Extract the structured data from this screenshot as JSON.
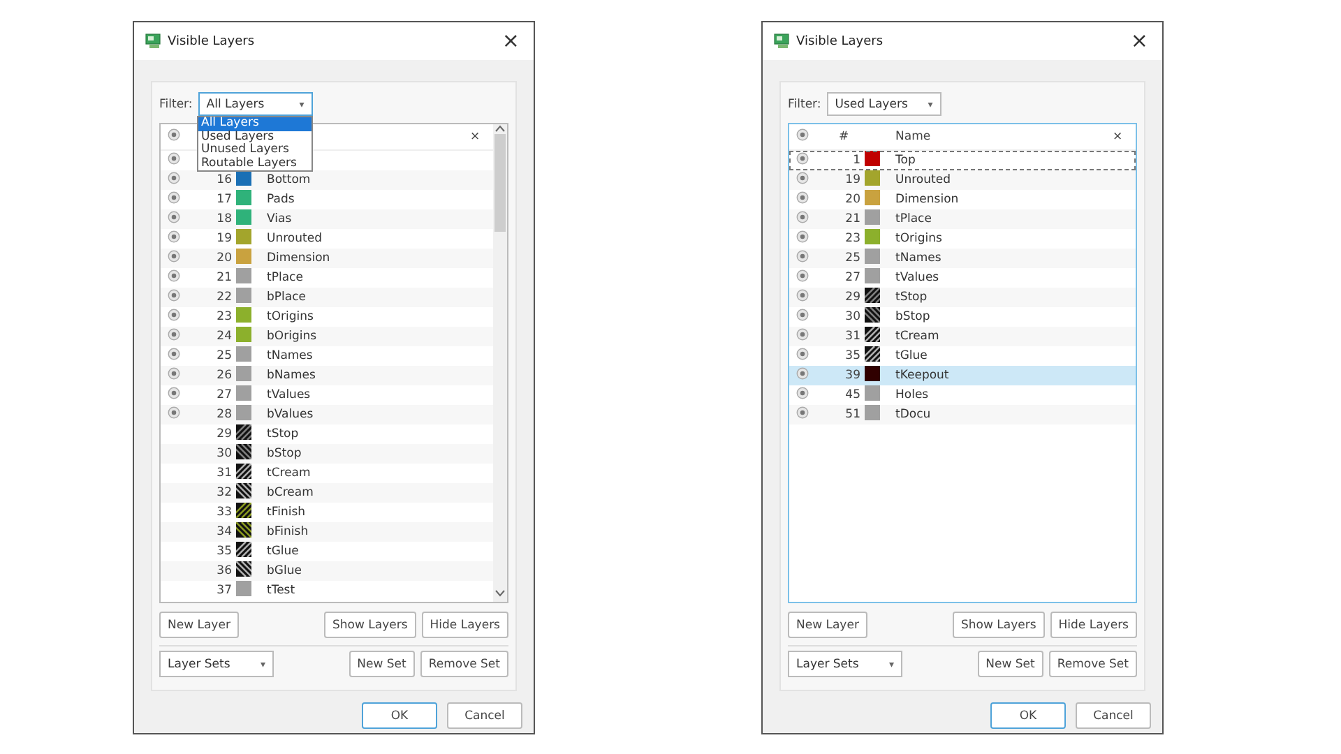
{
  "dialogs": [
    {
      "title": "Visible Layers",
      "close": "×",
      "filter": {
        "label": "Filter:",
        "value": "All Layers",
        "caret": "▾",
        "focused": true,
        "open": true,
        "options": [
          {
            "label": "All Layers",
            "selected": true
          },
          {
            "label": "Used Layers",
            "selected": false
          },
          {
            "label": "Unused Layers",
            "selected": false
          },
          {
            "label": "Routable Layers",
            "selected": false
          }
        ]
      },
      "table": {
        "header": {
          "close": "×"
        },
        "scrollbar": true,
        "rows": [
          {
            "visible": true,
            "selected": false
          },
          {
            "visible": true,
            "number": "16",
            "color": "#1a6fb5",
            "kind": "solid",
            "name": "Bottom",
            "selected": false
          },
          {
            "visible": true,
            "number": "17",
            "color": "#2fb27a",
            "kind": "solid",
            "name": "Pads",
            "selected": false
          },
          {
            "visible": true,
            "number": "18",
            "color": "#2fb27a",
            "kind": "solid",
            "name": "Vias",
            "selected": false
          },
          {
            "visible": true,
            "number": "19",
            "color": "#a3a52c",
            "kind": "solid",
            "name": "Unrouted",
            "selected": false
          },
          {
            "visible": true,
            "number": "20",
            "color": "#c9a23f",
            "kind": "solid",
            "name": "Dimension",
            "selected": false
          },
          {
            "visible": true,
            "number": "21",
            "color": "#a0a0a0",
            "kind": "solid",
            "name": "tPlace",
            "selected": false
          },
          {
            "visible": true,
            "number": "22",
            "color": "#a0a0a0",
            "kind": "solid",
            "name": "bPlace",
            "selected": false
          },
          {
            "visible": true,
            "number": "23",
            "color": "#8cb02c",
            "kind": "solid",
            "name": "tOrigins",
            "selected": false
          },
          {
            "visible": true,
            "number": "24",
            "color": "#8cb02c",
            "kind": "solid",
            "name": "bOrigins",
            "selected": false
          },
          {
            "visible": true,
            "number": "25",
            "color": "#a0a0a0",
            "kind": "solid",
            "name": "tNames",
            "selected": false
          },
          {
            "visible": true,
            "number": "26",
            "color": "#a0a0a0",
            "kind": "solid",
            "name": "bNames",
            "selected": false
          },
          {
            "visible": true,
            "number": "27",
            "color": "#a0a0a0",
            "kind": "solid",
            "name": "tValues",
            "selected": false
          },
          {
            "visible": true,
            "number": "28",
            "color": "#a0a0a0",
            "kind": "solid",
            "name": "bValues",
            "selected": false
          },
          {
            "visible": false,
            "number": "29",
            "color": "#808080",
            "kind": "hatch_up",
            "name": "tStop",
            "selected": false
          },
          {
            "visible": false,
            "number": "30",
            "color": "#808080",
            "kind": "hatch_down",
            "name": "bStop",
            "selected": false
          },
          {
            "visible": false,
            "number": "31",
            "color": "#b0b0b0",
            "kind": "hatch_up",
            "name": "tCream",
            "selected": false
          },
          {
            "visible": false,
            "number": "32",
            "color": "#b0b0b0",
            "kind": "hatch_down",
            "name": "bCream",
            "selected": false
          },
          {
            "visible": false,
            "number": "33",
            "color": "#8a9a20",
            "kind": "hatch_up",
            "name": "tFinish",
            "selected": false
          },
          {
            "visible": false,
            "number": "34",
            "color": "#8a9a20",
            "kind": "hatch_down",
            "name": "bFinish",
            "selected": false
          },
          {
            "visible": false,
            "number": "35",
            "color": "#b0b0b0",
            "kind": "hatch_up",
            "name": "tGlue",
            "selected": false
          },
          {
            "visible": false,
            "number": "36",
            "color": "#b0b0b0",
            "kind": "hatch_down",
            "name": "bGlue",
            "selected": false
          },
          {
            "visible": false,
            "number": "37",
            "color": "#a0a0a0",
            "kind": "solid",
            "name": "tTest",
            "selected": false
          }
        ]
      },
      "layer_buttons": [
        "New Layer",
        "Show Layers",
        "Hide Layers"
      ],
      "sets": {
        "value": "Layer Sets",
        "caret": "▾",
        "buttons": [
          "New Set",
          "Remove Set"
        ]
      },
      "footer": [
        {
          "label": "OK",
          "default": true
        },
        {
          "label": "Cancel",
          "default": false
        }
      ]
    },
    {
      "title": "Visible Layers",
      "close": "×",
      "filter": {
        "label": "Filter:",
        "value": "Used Layers",
        "caret": "▾",
        "focused": false,
        "open": false
      },
      "table": {
        "header": {
          "number": "#",
          "name": "Name",
          "close": "×"
        },
        "scrollbar": false,
        "rows": [
          {
            "visible": true,
            "number": "1",
            "color": "#c00000",
            "kind": "solid",
            "name": "Top",
            "selected": false,
            "focused": true
          },
          {
            "visible": true,
            "number": "19",
            "color": "#a3a52c",
            "kind": "solid",
            "name": "Unrouted",
            "selected": false,
            "focused": false
          },
          {
            "visible": true,
            "number": "20",
            "color": "#c9a23f",
            "kind": "solid",
            "name": "Dimension",
            "selected": false,
            "focused": false
          },
          {
            "visible": true,
            "number": "21",
            "color": "#a0a0a0",
            "kind": "solid",
            "name": "tPlace",
            "selected": false,
            "focused": false
          },
          {
            "visible": true,
            "number": "23",
            "color": "#8cb02c",
            "kind": "solid",
            "name": "tOrigins",
            "selected": false,
            "focused": false
          },
          {
            "visible": true,
            "number": "25",
            "color": "#a0a0a0",
            "kind": "solid",
            "name": "tNames",
            "selected": false,
            "focused": false
          },
          {
            "visible": true,
            "number": "27",
            "color": "#a0a0a0",
            "kind": "solid",
            "name": "tValues",
            "selected": false,
            "focused": false
          },
          {
            "visible": true,
            "number": "29",
            "color": "#808080",
            "kind": "hatch_up",
            "name": "tStop",
            "selected": false,
            "focused": false
          },
          {
            "visible": true,
            "number": "30",
            "color": "#808080",
            "kind": "hatch_down",
            "name": "bStop",
            "selected": false,
            "focused": false
          },
          {
            "visible": true,
            "number": "31",
            "color": "#b0b0b0",
            "kind": "hatch_up",
            "name": "tCream",
            "selected": false,
            "focused": false
          },
          {
            "visible": true,
            "number": "35",
            "color": "#b0b0b0",
            "kind": "hatch_up",
            "name": "tGlue",
            "selected": false,
            "focused": false
          },
          {
            "visible": true,
            "number": "39",
            "color": "#300000",
            "kind": "solid",
            "name": "tKeepout",
            "selected": true,
            "focused": false
          },
          {
            "visible": true,
            "number": "45",
            "color": "#a0a0a0",
            "kind": "solid",
            "name": "Holes",
            "selected": false,
            "focused": false
          },
          {
            "visible": true,
            "number": "51",
            "color": "#a0a0a0",
            "kind": "solid",
            "name": "tDocu",
            "selected": false,
            "focused": false
          }
        ]
      },
      "layer_buttons": [
        "New Layer",
        "Show Layers",
        "Hide Layers"
      ],
      "sets": {
        "value": "Layer Sets",
        "caret": "▾",
        "buttons": [
          "New Set",
          "Remove Set"
        ]
      },
      "footer": [
        {
          "label": "OK",
          "default": true
        },
        {
          "label": "Cancel",
          "default": false
        }
      ]
    }
  ]
}
